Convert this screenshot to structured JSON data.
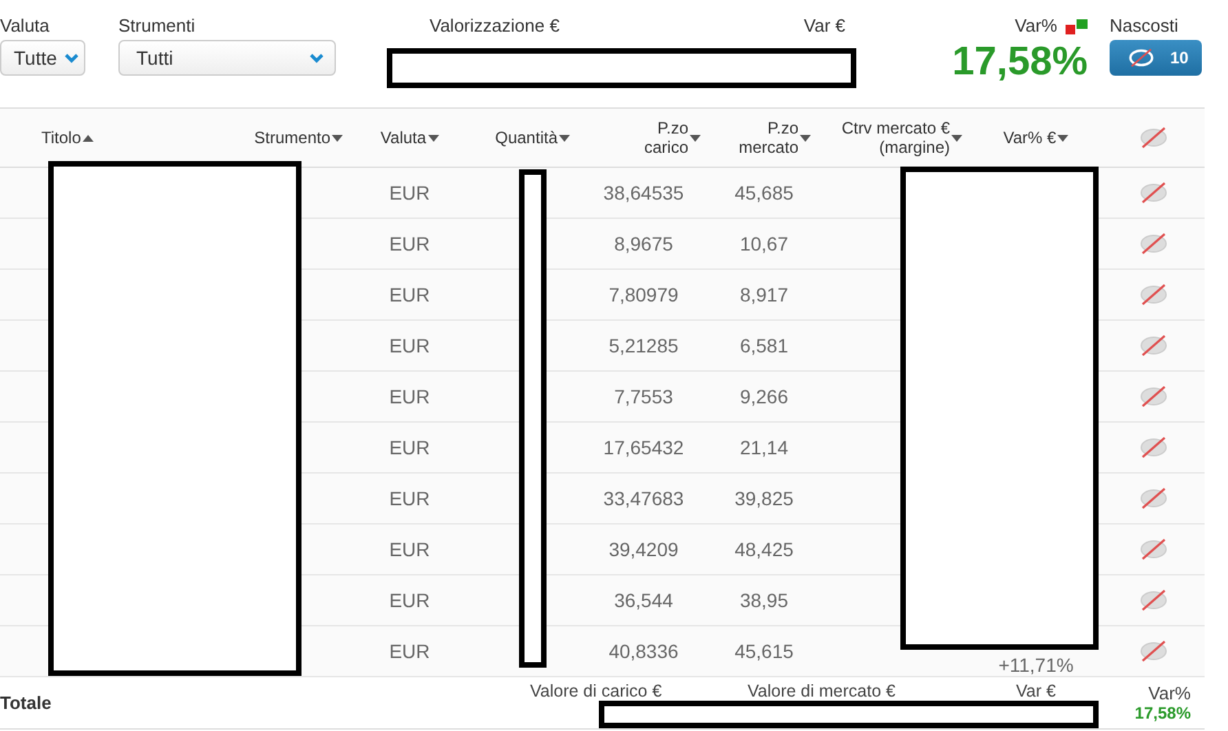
{
  "filters": [
    {
      "label": "Valuta",
      "value": "Tutte"
    },
    {
      "label": "Strumenti",
      "value": "Tutti"
    }
  ],
  "summary": {
    "valorizzazione_label": "Valorizzazione €",
    "var_label": "Var €",
    "var_pct_label": "Var%",
    "var_pct": "17,58%"
  },
  "hidden": {
    "label": "Nascosti",
    "count": "10"
  },
  "table": {
    "columns": [
      {
        "label": "Titolo",
        "ascending": true
      },
      {
        "label": "Strumento",
        "ascending": false
      },
      {
        "label": "Valuta",
        "ascending": false
      },
      {
        "label": "Quantità",
        "ascending": false
      },
      {
        "label": "P.zo\ncarico",
        "ascending": false
      },
      {
        "label": "P.zo\nmercato",
        "ascending": false
      },
      {
        "label": "Ctrv mercato €\n(margine)",
        "ascending": false
      },
      {
        "label": "Var% €",
        "ascending": false
      }
    ],
    "rows": [
      {
        "valuta": "EUR",
        "p_carico": "38,64535",
        "p_mercato": "45,685"
      },
      {
        "valuta": "EUR",
        "p_carico": "8,9675",
        "p_mercato": "10,67"
      },
      {
        "valuta": "EUR",
        "p_carico": "7,80979",
        "p_mercato": "8,917"
      },
      {
        "valuta": "EUR",
        "p_carico": "5,21285",
        "p_mercato": "6,581"
      },
      {
        "valuta": "EUR",
        "p_carico": "7,7553",
        "p_mercato": "9,266"
      },
      {
        "valuta": "EUR",
        "p_carico": "17,65432",
        "p_mercato": "21,14"
      },
      {
        "valuta": "EUR",
        "p_carico": "33,47683",
        "p_mercato": "39,825"
      },
      {
        "valuta": "EUR",
        "p_carico": "39,4209",
        "p_mercato": "48,425"
      },
      {
        "valuta": "EUR",
        "p_carico": "36,544",
        "p_mercato": "38,95"
      },
      {
        "valuta": "EUR",
        "p_carico": "40,8336",
        "p_mercato": "45,615",
        "var_pct": "+11,71%"
      }
    ],
    "totals": {
      "label": "Totale",
      "carico_label": "Valore di carico €",
      "mercato_label": "Valore di mercato €",
      "var_label": "Var €",
      "var_pct_label": "Var%",
      "var_pct": "17,58%"
    }
  }
}
